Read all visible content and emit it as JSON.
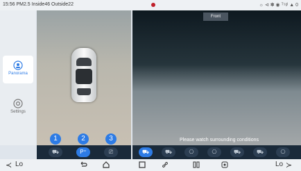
{
  "statusbar": {
    "left_text": "15:56 PM2.5 Inside46 Outside22",
    "right_text": "☼ ⊲ ✽ ◉ ᵀ⁵ᵍˡ ▲ 0"
  },
  "sidebar": {
    "items": [
      {
        "label": "Panorama",
        "icon": "camera-circle-icon",
        "active": true
      },
      {
        "label": "Settings",
        "icon": "settings-circle-icon",
        "active": false
      }
    ]
  },
  "left_panel": {
    "view_numbers": [
      "1",
      "2",
      "3"
    ]
  },
  "view_buttons": [
    {
      "icon": "car-front-icon",
      "label": "⛟"
    },
    {
      "icon": "parking-icon",
      "label": "P⁺",
      "active": true
    },
    {
      "icon": "exit-icon",
      "label": "⎚"
    }
  ],
  "right_panel": {
    "mode_label": "Front",
    "warning": "Please watch surrounding conditions"
  },
  "camera_buttons": [
    {
      "icon": "car-front-view-icon",
      "active": true
    },
    {
      "icon": "car-rear-view-icon"
    },
    {
      "icon": "car-left-view-icon"
    },
    {
      "icon": "car-right-view-icon"
    },
    {
      "icon": "car-3d-front-icon"
    },
    {
      "icon": "car-3d-rear-icon"
    },
    {
      "icon": "car-3d-side-icon"
    }
  ],
  "navbar": {
    "left_temp": "Lo",
    "right_temp": "Lo"
  }
}
